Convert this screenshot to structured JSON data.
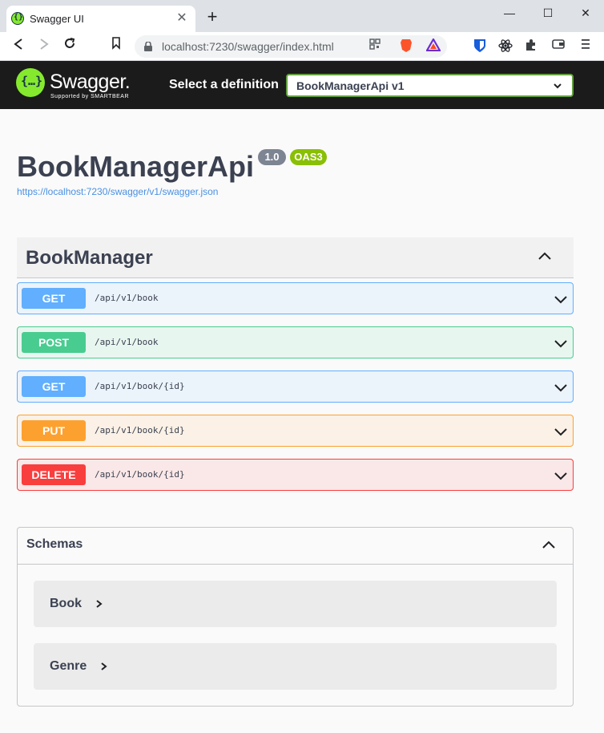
{
  "browser": {
    "tab_title": "Swagger UI",
    "tab_close": "✕",
    "new_tab": "+",
    "url": "localhost:7230/swagger/index.html",
    "window_controls": {
      "minimize": "—",
      "maximize": "☐",
      "close": "✕"
    }
  },
  "topbar": {
    "logo_glyph": "{…}",
    "brand": "Swagger.",
    "tagline": "Supported by SMARTBEAR",
    "select_label": "Select a definition",
    "selected_definition": "BookManagerApi v1"
  },
  "info": {
    "title": "BookManagerApi",
    "version": "1.0",
    "oas": "OAS3",
    "spec_url": "https://localhost:7230/swagger/v1/swagger.json"
  },
  "tag": {
    "name": "BookManager"
  },
  "operations": [
    {
      "method": "GET",
      "path": "/api/v1/book"
    },
    {
      "method": "POST",
      "path": "/api/v1/book"
    },
    {
      "method": "GET",
      "path": "/api/v1/book/{id}"
    },
    {
      "method": "PUT",
      "path": "/api/v1/book/{id}"
    },
    {
      "method": "DELETE",
      "path": "/api/v1/book/{id}"
    }
  ],
  "schemas": {
    "title": "Schemas",
    "models": [
      "Book",
      "Genre"
    ]
  },
  "colors": {
    "get": "#61affe",
    "post": "#49cc90",
    "put": "#fca130",
    "delete": "#f93e3e",
    "swagger_green": "#85ea2d",
    "topbar_bg": "#1b1b1b"
  }
}
